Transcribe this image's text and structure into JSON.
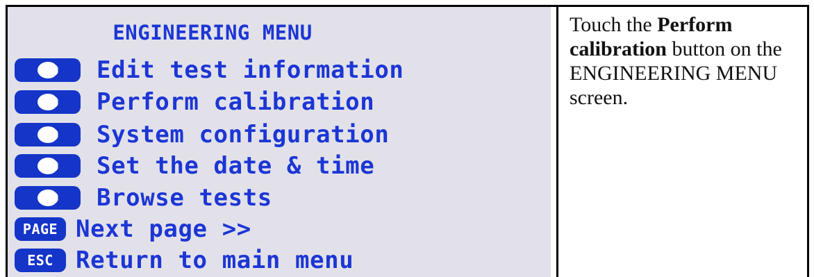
{
  "screen": {
    "title": "ENGINEERING MENU",
    "items": [
      {
        "key_icon": "octagon-button-icon",
        "label": "Edit test information"
      },
      {
        "key_icon": "octagon-button-icon",
        "label": "Perform calibration"
      },
      {
        "key_icon": "octagon-button-icon",
        "label": "System configuration"
      },
      {
        "key_icon": "octagon-button-icon",
        "label": "Set the date & time"
      },
      {
        "key_icon": "octagon-button-icon",
        "label": "Browse tests"
      },
      {
        "key_text": "PAGE",
        "label": "Next page >>"
      },
      {
        "key_text": "ESC",
        "label": "Return to main menu"
      }
    ]
  },
  "instruction": {
    "before": "Touch the ",
    "bold": "Perform calibration",
    "after": " button on the ENGINEERING MENU screen."
  },
  "colors": {
    "screen_background": "#e2e1ea",
    "button_blue": "#1435c8",
    "text_blue": "#1c36d4"
  }
}
